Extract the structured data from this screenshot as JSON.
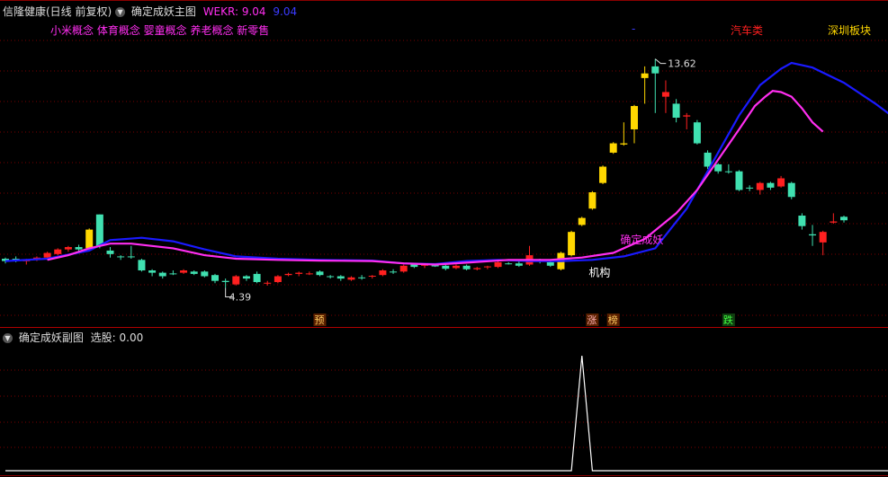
{
  "header": {
    "stock_name": "信隆健康(日线 前复权)",
    "main_indicator": "确定成妖主图",
    "wekr_label": "WEKR: 9.04",
    "wekr_value": "9.04",
    "concepts": "小米概念 体育概念 婴童概念 养老概念 新零售",
    "sector_label": "深圳板块",
    "sector_label2": "汽车类",
    "dash": "-"
  },
  "sub_header": {
    "indicator": "确定成妖副图",
    "selection_label": "选股: 0.00"
  },
  "colors": {
    "up_candle": "#ff2020",
    "down_candle": "#40e0b0",
    "signal_candle": "#ffd700",
    "ma_line": "#1a1aff",
    "trend_line": "#ff2ef0",
    "grid": "#7a0000",
    "sub_line": "#ffffff"
  },
  "chart_data": {
    "type": "candlestick",
    "price_range": [
      2.2,
      15.3
    ],
    "annotations": {
      "high_label": "13.62",
      "low_label": "4.39",
      "signal_label": "确定成妖",
      "institution_label": "机构",
      "markers": [
        {
          "text": "预",
          "bar": 30
        },
        {
          "text": "涨",
          "bar": 56
        },
        {
          "text": "榜",
          "bar": 58
        },
        {
          "text": "跌",
          "bar": 69
        }
      ]
    },
    "candles": [
      {
        "o": 4.95,
        "c": 5.05,
        "h": 5.1,
        "l": 4.85,
        "k": "down"
      },
      {
        "o": 5.05,
        "c": 5.0,
        "h": 5.15,
        "l": 4.9,
        "k": "down"
      },
      {
        "o": 4.95,
        "c": 4.98,
        "h": 5.05,
        "l": 4.8,
        "k": "up"
      },
      {
        "o": 5.0,
        "c": 5.1,
        "h": 5.15,
        "l": 4.95,
        "k": "up"
      },
      {
        "o": 5.1,
        "c": 5.3,
        "h": 5.35,
        "l": 5.05,
        "k": "up"
      },
      {
        "o": 5.25,
        "c": 5.45,
        "h": 5.5,
        "l": 5.2,
        "k": "up"
      },
      {
        "o": 5.45,
        "c": 5.55,
        "h": 5.6,
        "l": 5.35,
        "k": "up"
      },
      {
        "o": 5.55,
        "c": 5.45,
        "h": 5.65,
        "l": 5.35,
        "k": "down"
      },
      {
        "o": 5.5,
        "c": 6.3,
        "h": 6.35,
        "l": 5.45,
        "k": "signal"
      },
      {
        "o": 6.95,
        "c": 5.6,
        "h": 6.95,
        "l": 5.5,
        "k": "down"
      },
      {
        "o": 5.4,
        "c": 5.25,
        "h": 5.55,
        "l": 5.1,
        "k": "down"
      },
      {
        "o": 5.15,
        "c": 5.12,
        "h": 5.2,
        "l": 5.0,
        "k": "down"
      },
      {
        "o": 5.15,
        "c": 5.13,
        "h": 5.6,
        "l": 5.05,
        "k": "down"
      },
      {
        "o": 5.0,
        "c": 4.55,
        "h": 5.05,
        "l": 4.5,
        "k": "down"
      },
      {
        "o": 4.55,
        "c": 4.45,
        "h": 4.6,
        "l": 4.3,
        "k": "down"
      },
      {
        "o": 4.45,
        "c": 4.3,
        "h": 4.5,
        "l": 4.2,
        "k": "down"
      },
      {
        "o": 4.4,
        "c": 4.42,
        "h": 4.55,
        "l": 4.35,
        "k": "down"
      },
      {
        "o": 4.45,
        "c": 4.55,
        "h": 4.6,
        "l": 4.4,
        "k": "up"
      },
      {
        "o": 4.5,
        "c": 4.4,
        "h": 4.55,
        "l": 4.35,
        "k": "down"
      },
      {
        "o": 4.5,
        "c": 4.3,
        "h": 4.55,
        "l": 4.25,
        "k": "down"
      },
      {
        "o": 4.35,
        "c": 4.1,
        "h": 4.4,
        "l": 4.0,
        "k": "down"
      },
      {
        "o": 4.1,
        "c": 4.05,
        "h": 4.2,
        "l": 3.8,
        "k": "down"
      },
      {
        "o": 3.95,
        "c": 4.3,
        "h": 4.35,
        "l": 3.9,
        "k": "up"
      },
      {
        "o": 4.2,
        "c": 4.3,
        "h": 4.35,
        "l": 4.1,
        "k": "down"
      },
      {
        "o": 4.4,
        "c": 4.05,
        "h": 4.5,
        "l": 4.0,
        "k": "down"
      },
      {
        "o": 4.0,
        "c": 4.02,
        "h": 4.1,
        "l": 3.9,
        "k": "up"
      },
      {
        "o": 4.05,
        "c": 4.3,
        "h": 4.35,
        "l": 4.0,
        "k": "up"
      },
      {
        "o": 4.35,
        "c": 4.4,
        "h": 4.45,
        "l": 4.3,
        "k": "up"
      },
      {
        "o": 4.4,
        "c": 4.45,
        "h": 4.5,
        "l": 4.3,
        "k": "up"
      },
      {
        "o": 4.4,
        "c": 4.42,
        "h": 4.5,
        "l": 4.35,
        "k": "up"
      },
      {
        "o": 4.5,
        "c": 4.35,
        "h": 4.55,
        "l": 4.3,
        "k": "down"
      },
      {
        "o": 4.3,
        "c": 4.28,
        "h": 4.35,
        "l": 4.2,
        "k": "down"
      },
      {
        "o": 4.3,
        "c": 4.2,
        "h": 4.35,
        "l": 4.1,
        "k": "down"
      },
      {
        "o": 4.15,
        "c": 4.25,
        "h": 4.3,
        "l": 4.1,
        "k": "up"
      },
      {
        "o": 4.25,
        "c": 4.22,
        "h": 4.35,
        "l": 4.15,
        "k": "down"
      },
      {
        "o": 4.3,
        "c": 4.32,
        "h": 4.35,
        "l": 4.2,
        "k": "up"
      },
      {
        "o": 4.35,
        "c": 4.55,
        "h": 4.6,
        "l": 4.3,
        "k": "up"
      },
      {
        "o": 4.5,
        "c": 4.5,
        "h": 4.6,
        "l": 4.4,
        "k": "down"
      },
      {
        "o": 4.5,
        "c": 4.75,
        "h": 4.8,
        "l": 4.45,
        "k": "up"
      },
      {
        "o": 4.8,
        "c": 4.7,
        "h": 4.85,
        "l": 4.65,
        "k": "down"
      },
      {
        "o": 4.75,
        "c": 4.8,
        "h": 4.85,
        "l": 4.65,
        "k": "up"
      },
      {
        "o": 4.8,
        "c": 4.72,
        "h": 4.85,
        "l": 4.7,
        "k": "down"
      },
      {
        "o": 4.75,
        "c": 4.62,
        "h": 4.8,
        "l": 4.55,
        "k": "down"
      },
      {
        "o": 4.65,
        "c": 4.75,
        "h": 4.8,
        "l": 4.6,
        "k": "up"
      },
      {
        "o": 4.75,
        "c": 4.6,
        "h": 4.8,
        "l": 4.55,
        "k": "down"
      },
      {
        "o": 4.6,
        "c": 4.65,
        "h": 4.7,
        "l": 4.55,
        "k": "up"
      },
      {
        "o": 4.7,
        "c": 4.72,
        "h": 4.75,
        "l": 4.6,
        "k": "up"
      },
      {
        "o": 4.7,
        "c": 4.9,
        "h": 4.95,
        "l": 4.65,
        "k": "up"
      },
      {
        "o": 4.85,
        "c": 4.85,
        "h": 4.9,
        "l": 4.8,
        "k": "down"
      },
      {
        "o": 4.85,
        "c": 4.75,
        "h": 4.95,
        "l": 4.7,
        "k": "down"
      },
      {
        "o": 4.8,
        "c": 5.2,
        "h": 5.6,
        "l": 4.75,
        "k": "up"
      },
      {
        "o": 5.0,
        "c": 4.95,
        "h": 5.05,
        "l": 4.85,
        "k": "down"
      },
      {
        "o": 4.9,
        "c": 4.75,
        "h": 5.0,
        "l": 4.7,
        "k": "down"
      },
      {
        "o": 4.6,
        "c": 5.3,
        "h": 5.35,
        "l": 4.55,
        "k": "signal"
      },
      {
        "o": 5.2,
        "c": 6.2,
        "h": 6.25,
        "l": 5.15,
        "k": "signal"
      },
      {
        "o": 6.5,
        "c": 6.8,
        "h": 6.85,
        "l": 6.45,
        "k": "signal"
      },
      {
        "o": 7.2,
        "c": 7.9,
        "h": 7.95,
        "l": 7.15,
        "k": "signal"
      },
      {
        "o": 8.3,
        "c": 9.0,
        "h": 9.05,
        "l": 8.25,
        "k": "signal"
      },
      {
        "o": 9.6,
        "c": 10.0,
        "h": 10.05,
        "l": 9.55,
        "k": "signal"
      },
      {
        "o": 9.95,
        "c": 10.0,
        "h": 10.9,
        "l": 9.9,
        "k": "signal"
      },
      {
        "o": 10.6,
        "c": 11.6,
        "h": 11.65,
        "l": 10.0,
        "k": "signal"
      },
      {
        "o": 12.8,
        "c": 13.0,
        "h": 13.3,
        "l": 11.7,
        "k": "signal"
      },
      {
        "o": 13.3,
        "c": 13.0,
        "h": 13.62,
        "l": 11.3,
        "k": "down"
      },
      {
        "o": 12.0,
        "c": 12.2,
        "h": 12.7,
        "l": 11.3,
        "k": "up"
      },
      {
        "o": 11.7,
        "c": 11.1,
        "h": 11.9,
        "l": 10.9,
        "k": "down"
      },
      {
        "o": 11.2,
        "c": 11.15,
        "h": 11.3,
        "l": 10.6,
        "k": "up"
      },
      {
        "o": 10.9,
        "c": 10.0,
        "h": 11.0,
        "l": 9.95,
        "k": "down"
      },
      {
        "o": 9.6,
        "c": 9.0,
        "h": 9.7,
        "l": 8.9,
        "k": "down"
      },
      {
        "o": 9.1,
        "c": 8.8,
        "h": 9.15,
        "l": 8.7,
        "k": "down"
      },
      {
        "o": 8.8,
        "c": 8.8,
        "h": 9.1,
        "l": 8.7,
        "k": "down"
      },
      {
        "o": 8.8,
        "c": 8.0,
        "h": 8.85,
        "l": 7.95,
        "k": "down"
      },
      {
        "o": 8.1,
        "c": 8.07,
        "h": 8.2,
        "l": 7.95,
        "k": "down"
      },
      {
        "o": 8.0,
        "c": 8.3,
        "h": 8.35,
        "l": 7.8,
        "k": "up"
      },
      {
        "o": 8.3,
        "c": 8.1,
        "h": 8.35,
        "l": 8.0,
        "k": "down"
      },
      {
        "o": 8.15,
        "c": 8.5,
        "h": 8.6,
        "l": 8.1,
        "k": "up"
      },
      {
        "o": 8.3,
        "c": 7.7,
        "h": 8.35,
        "l": 7.6,
        "k": "down"
      },
      {
        "o": 6.9,
        "c": 6.45,
        "h": 7.0,
        "l": 6.3,
        "k": "down"
      },
      {
        "o": 6.1,
        "c": 6.05,
        "h": 6.5,
        "l": 5.6,
        "k": "down"
      },
      {
        "o": 5.75,
        "c": 6.2,
        "h": 6.25,
        "l": 5.2,
        "k": "up"
      },
      {
        "o": 6.6,
        "c": 6.65,
        "h": 7.0,
        "l": 6.55,
        "k": "up"
      },
      {
        "o": 6.85,
        "c": 6.7,
        "h": 6.9,
        "l": 6.6,
        "k": "down"
      }
    ],
    "ma_curve": [
      [
        0,
        4.95
      ],
      [
        4,
        5.05
      ],
      [
        8,
        5.4
      ],
      [
        10,
        5.85
      ],
      [
        13,
        5.95
      ],
      [
        16,
        5.8
      ],
      [
        19,
        5.45
      ],
      [
        22,
        5.15
      ],
      [
        26,
        5.05
      ],
      [
        30,
        5.0
      ],
      [
        35,
        4.97
      ],
      [
        38,
        4.85
      ],
      [
        41,
        4.82
      ],
      [
        44,
        4.95
      ],
      [
        47,
        5.0
      ],
      [
        50,
        4.95
      ],
      [
        53,
        4.95
      ],
      [
        56,
        5.0
      ],
      [
        59,
        5.15
      ],
      [
        62,
        5.5
      ],
      [
        65,
        7.2
      ],
      [
        68,
        9.6
      ],
      [
        70,
        11.2
      ],
      [
        72,
        12.5
      ],
      [
        74,
        13.2
      ],
      [
        75,
        13.45
      ],
      [
        77,
        13.25
      ],
      [
        80,
        12.6
      ],
      [
        83,
        11.7
      ],
      [
        86,
        10.7
      ],
      [
        89,
        9.4
      ],
      [
        92,
        9.05
      ],
      [
        95,
        8.8
      ],
      [
        98,
        8.6
      ]
    ],
    "trend_curve": [
      [
        4,
        5.0
      ],
      [
        6,
        5.2
      ],
      [
        8,
        5.5
      ],
      [
        10,
        5.7
      ],
      [
        12,
        5.7
      ],
      [
        14,
        5.6
      ],
      [
        16,
        5.5
      ],
      [
        19,
        5.2
      ],
      [
        22,
        5.05
      ],
      [
        26,
        5.0
      ],
      [
        30,
        4.97
      ],
      [
        35,
        4.95
      ],
      [
        38,
        4.85
      ],
      [
        41,
        4.8
      ],
      [
        44,
        4.88
      ],
      [
        48,
        5.0
      ],
      [
        52,
        5.0
      ],
      [
        55,
        5.1
      ],
      [
        58,
        5.3
      ],
      [
        61,
        5.9
      ],
      [
        64,
        7.0
      ],
      [
        66,
        8.0
      ],
      [
        68,
        9.3
      ],
      [
        70,
        10.6
      ],
      [
        71.5,
        11.6
      ],
      [
        72.5,
        12.0
      ],
      [
        73.2,
        12.25
      ],
      [
        74,
        12.2
      ],
      [
        75,
        12.0
      ],
      [
        76,
        11.5
      ],
      [
        77,
        10.9
      ],
      [
        78,
        10.5
      ]
    ],
    "sub_curve": {
      "range": [
        0,
        1
      ],
      "points": [
        [
          0,
          0
        ],
        [
          54,
          0
        ],
        [
          55.0,
          1
        ],
        [
          56,
          0
        ],
        [
          90,
          0
        ]
      ]
    }
  }
}
